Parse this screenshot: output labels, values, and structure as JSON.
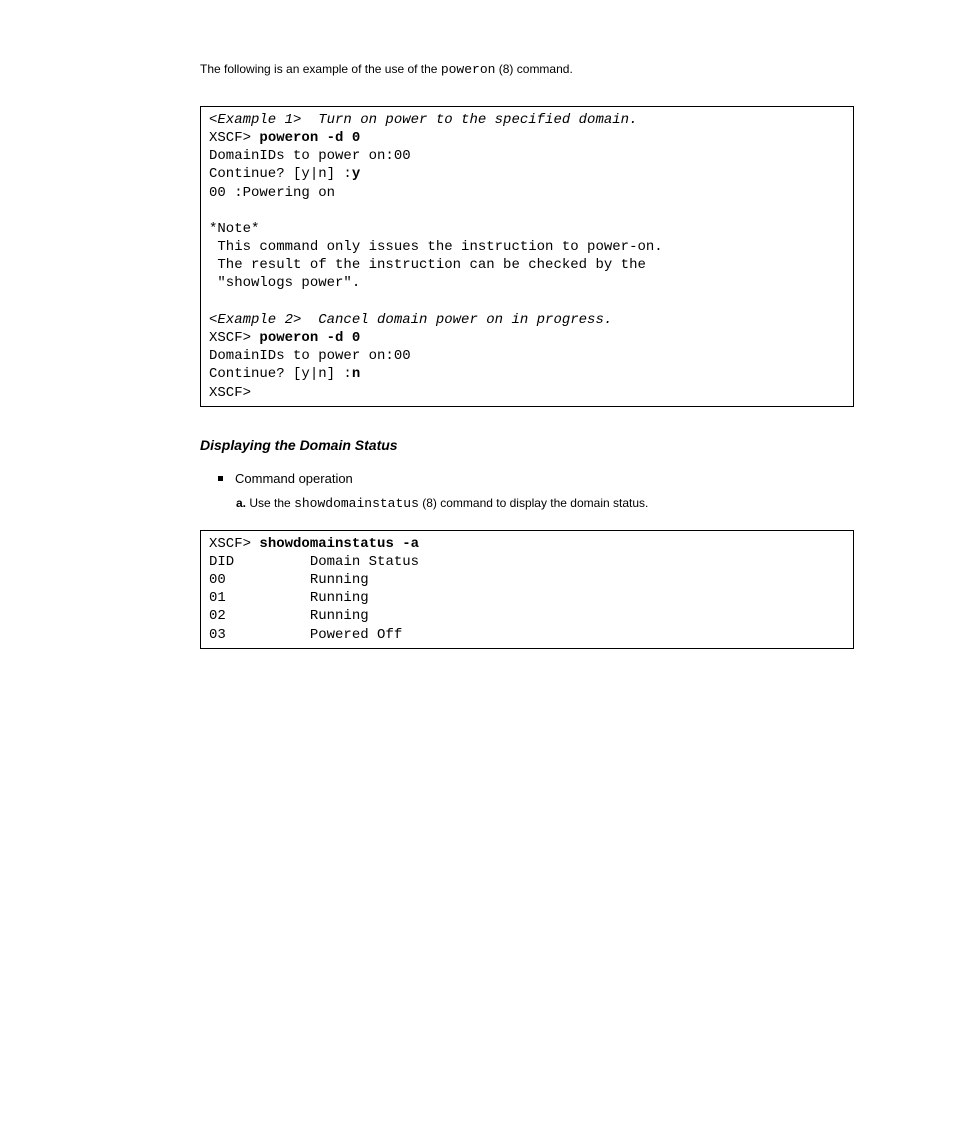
{
  "intro_prefix": "The following is an example of the use of the ",
  "intro_cmd": "poweron",
  "intro_suffix": "(8) command.",
  "example1_heading": "<Example 1>  Turn on power to the specified domain.",
  "ex1": {
    "prompt1": "XSCF> ",
    "cmd1": "poweron -d 0",
    "line1": "DomainIDs to power on:00",
    "line2a": "Continue? [y|n] :",
    "line2b": "y",
    "line3": "00 :Powering on",
    "blank": "",
    "note": "*Note*",
    "note1": " This command only issues the instruction to power-on.",
    "note2": " The result of the instruction can be checked by the ",
    "note3": " \"showlogs power\"."
  },
  "example2_heading": "<Example 2>  Cancel domain power on in progress.",
  "ex2": {
    "prompt1": "XSCF> ",
    "cmd1": "poweron -d 0",
    "line1": "DomainIDs to power on:00",
    "line2a": "Continue? [y|n] :",
    "line2b": "n",
    "prompt2": "XSCF> "
  },
  "section_heading": "Displaying the Domain Status",
  "bullet_label": "Command operation",
  "step_a": "a.",
  "step_text_prefix": "Use the ",
  "step_cmd": "showdomainstatus",
  "step_text_suffix": "(8) command to display the domain status.",
  "status_block": {
    "prompt": "XSCF> ",
    "cmd": "showdomainstatus -a",
    "header_left": "DID",
    "header_right": "Domain Status",
    "rows": [
      {
        "did": "00",
        "status": "Running"
      },
      {
        "did": "01",
        "status": "Running"
      },
      {
        "did": "02",
        "status": "Running"
      },
      {
        "did": "03",
        "status": "Powered Off"
      }
    ]
  }
}
